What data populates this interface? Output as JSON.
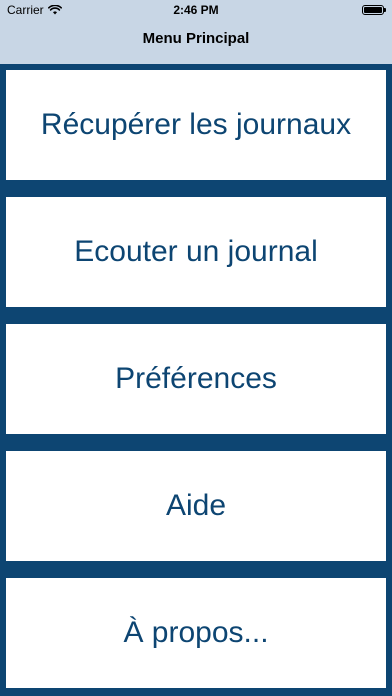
{
  "status_bar": {
    "carrier": "Carrier",
    "time": "2:46 PM",
    "wifi_icon": "wifi-icon",
    "battery_level": 1.0
  },
  "nav": {
    "title": "Menu Principal"
  },
  "menu": {
    "items": [
      {
        "label": "Récupérer les journaux"
      },
      {
        "label": "Ecouter un journal"
      },
      {
        "label": "Préférences"
      },
      {
        "label": "Aide"
      },
      {
        "label": "À propos..."
      }
    ]
  },
  "colors": {
    "background": "#0d4572",
    "header": "#c8d6e5",
    "item_bg": "#ffffff",
    "item_text": "#0d4572"
  }
}
